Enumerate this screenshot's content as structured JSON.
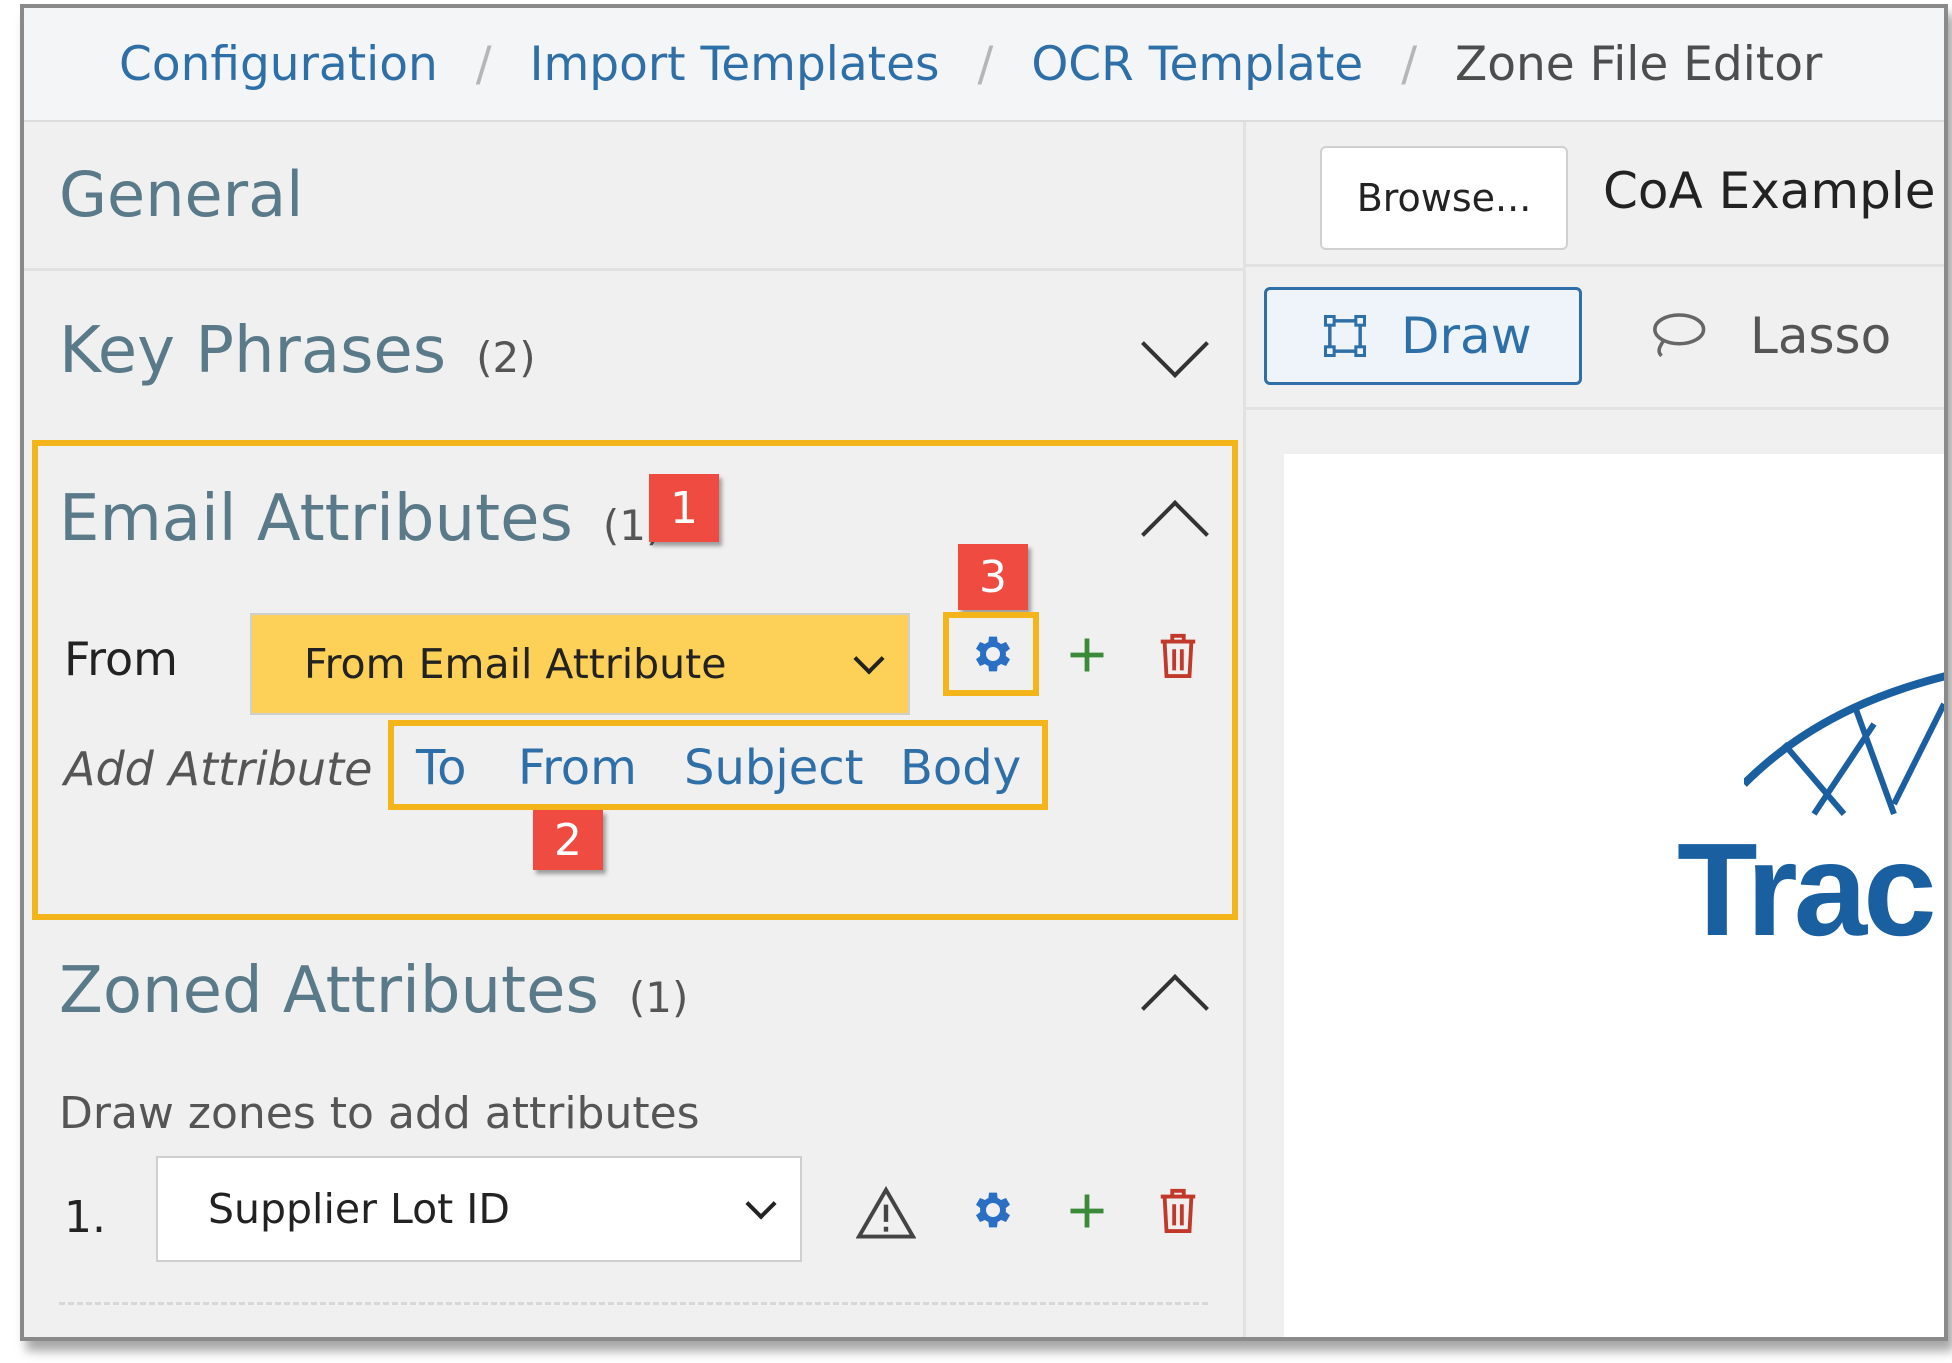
{
  "breadcrumb": {
    "items": [
      "Configuration",
      "Import Templates",
      "OCR Template"
    ],
    "current": "Zone File Editor",
    "separator": "/"
  },
  "left_panel": {
    "general": {
      "title": "General"
    },
    "key_phrases": {
      "title": "Key Phrases",
      "count": "(2)",
      "state": "collapsed"
    },
    "email_attributes": {
      "title": "Email Attributes",
      "count": "(1)",
      "state": "expanded",
      "row": {
        "label": "From",
        "selected": "From Email Attribute"
      },
      "add_attribute": {
        "label": "Add Attribute",
        "options": [
          "To",
          "From",
          "Subject",
          "Body"
        ]
      }
    },
    "zoned_attributes": {
      "title": "Zoned Attributes",
      "count": "(1)",
      "state": "expanded",
      "hint": "Draw zones to add attributes",
      "row": {
        "index": "1.",
        "selected": "Supplier Lot ID"
      }
    }
  },
  "markers": {
    "m1": "1",
    "m2": "2",
    "m3": "3"
  },
  "right_panel": {
    "browse_label": "Browse...",
    "file_name": "CoA Example w",
    "tools": {
      "draw": "Draw",
      "lasso": "Lasso"
    },
    "logo_text": "Trac"
  },
  "colors": {
    "link": "#2f6fa8",
    "highlight": "#f3b51a",
    "marker": "#ef4b40",
    "selected_field": "#fdd057",
    "gear": "#2a6fc4",
    "plus": "#3a8a3a",
    "trash": "#c0392b"
  },
  "icons": [
    "chevron-down-icon",
    "chevron-up-icon",
    "gear-icon",
    "plus-icon",
    "trash-icon",
    "warning-icon",
    "draw-icon",
    "lasso-icon"
  ]
}
